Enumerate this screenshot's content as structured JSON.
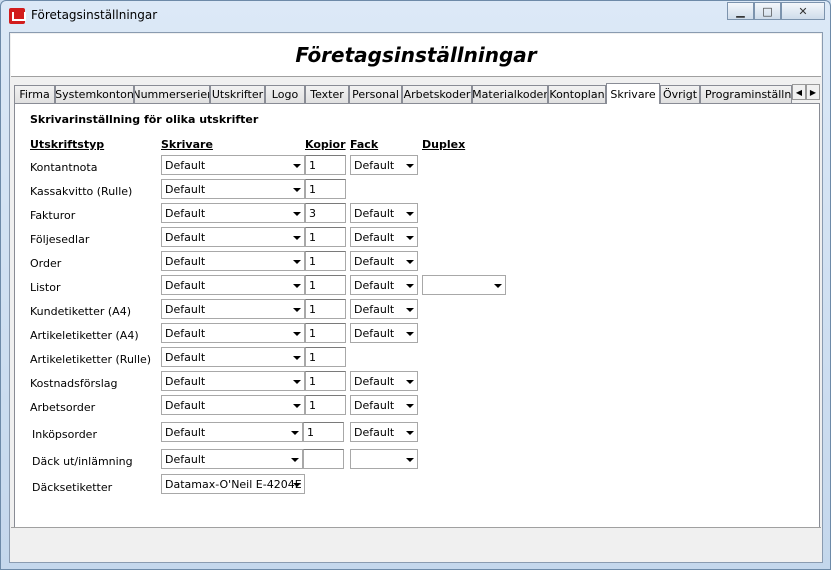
{
  "window": {
    "title": "Företagsinställningar"
  },
  "header": {
    "title": "Företagsinställningar"
  },
  "tabs": [
    {
      "label": "Firma"
    },
    {
      "label": "Systemkonton"
    },
    {
      "label": "Nummerserier"
    },
    {
      "label": "Utskrifter"
    },
    {
      "label": "Logo"
    },
    {
      "label": "Texter"
    },
    {
      "label": "Personal"
    },
    {
      "label": "Arbetskoder"
    },
    {
      "label": "Materialkoder"
    },
    {
      "label": "Kontoplan"
    },
    {
      "label": "Skrivare"
    },
    {
      "label": "Övrigt"
    },
    {
      "label": "Programinställning"
    }
  ],
  "active_tab": "Skrivare",
  "section": {
    "title": "Skrivarinställning för olika utskrifter"
  },
  "columns": {
    "type": "Utskriftstyp",
    "printer": "Skrivare",
    "copies": "Kopior",
    "tray": "Fack",
    "duplex": "Duplex"
  },
  "rows": [
    {
      "label": "Kontantnota",
      "printer": "Default",
      "copies": "1",
      "tray": "Default"
    },
    {
      "label": "Kassakvitto (Rulle)",
      "printer": "Default",
      "copies": "1"
    },
    {
      "label": "Fakturor",
      "printer": "Default",
      "copies": "3",
      "tray": "Default"
    },
    {
      "label": "Följesedlar",
      "printer": "Default",
      "copies": "1",
      "tray": "Default"
    },
    {
      "label": "Order",
      "printer": "Default",
      "copies": "1",
      "tray": "Default"
    },
    {
      "label": "Listor",
      "printer": "Default",
      "copies": "1",
      "tray": "Default",
      "duplex": ""
    },
    {
      "label": "Kundetiketter (A4)",
      "printer": "Default",
      "copies": "1",
      "tray": "Default"
    },
    {
      "label": "Artikeletiketter (A4)",
      "printer": "Default",
      "copies": "1",
      "tray": "Default"
    },
    {
      "label": "Artikeletiketter (Rulle)",
      "printer": "Default",
      "copies": "1"
    },
    {
      "label": "Kostnadsförslag",
      "printer": "Default",
      "copies": "1",
      "tray": "Default"
    },
    {
      "label": "Arbetsorder",
      "printer": "Default",
      "copies": "1",
      "tray": "Default"
    },
    {
      "label": "Inköpsorder",
      "printer": "Default",
      "copies": "1",
      "tray": "Default"
    },
    {
      "label": "Däck ut/inlämning",
      "printer": "Default",
      "copies": "",
      "tray": ""
    },
    {
      "label": "Däcksetiketter",
      "printer": "Datamax-O'Neil E-4204E"
    }
  ]
}
